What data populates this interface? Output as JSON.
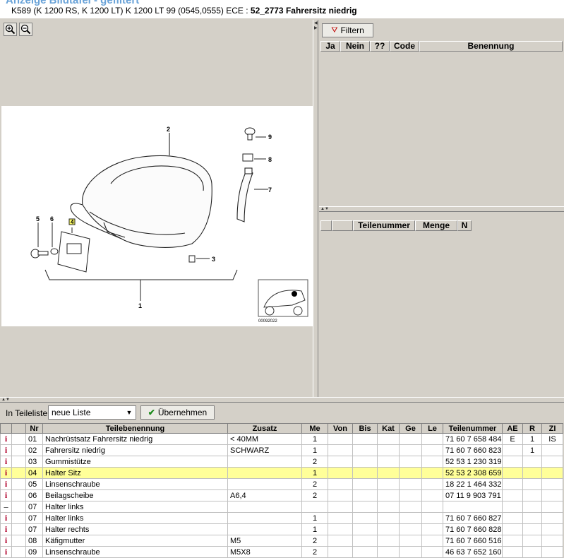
{
  "header": {
    "top_title": "Anzeige Bildtafel - gefiltert",
    "subtitle_prefix": "K589 (K 1200 RS, K 1200 LT) K 1200 LT 99 (0545,0555) ECE : ",
    "subtitle_bold": "52_2773 Fahrersitz niedrig"
  },
  "image_toolbar": {
    "zoom_in_icon": "zoom-in-icon",
    "zoom_out_icon": "zoom-out-icon"
  },
  "diagram": {
    "callouts": [
      "1",
      "2",
      "3",
      "4",
      "5",
      "6",
      "7",
      "8",
      "9"
    ],
    "image_code": "00092022"
  },
  "filter_panel": {
    "filter_label": "Filtern",
    "columns": [
      "Ja",
      "Nein",
      "??",
      "Code",
      "Benennung"
    ]
  },
  "detail_panel": {
    "columns": [
      "",
      "",
      "Teilenummer",
      "Menge",
      "N"
    ]
  },
  "parts_toolbar": {
    "list_label": "In Teileliste",
    "list_value": "neue Liste",
    "apply_label": "Übernehmen"
  },
  "parts_table": {
    "columns": [
      "",
      "Nr",
      "Teilebenennung",
      "Zusatz",
      "Me",
      "Von",
      "Bis",
      "Kat",
      "Ge",
      "Le",
      "Teilenummer",
      "AE",
      "R",
      "ZI"
    ],
    "rows": [
      {
        "icon": "i",
        "nr": "01",
        "name": "Nachrüstsatz Fahrersitz niedrig",
        "zusatz": "< 40MM",
        "me": "1",
        "von": "",
        "bis": "",
        "kat": "",
        "ge": "",
        "le": "",
        "teilenummer": "71 60 7 658 484",
        "ae": "E",
        "r": "1",
        "zi": "IS",
        "selected": false
      },
      {
        "icon": "i",
        "nr": "02",
        "name": "Fahrersitz niedrig",
        "zusatz": "SCHWARZ",
        "me": "1",
        "von": "",
        "bis": "",
        "kat": "",
        "ge": "",
        "le": "",
        "teilenummer": "71 60 7 660 823",
        "ae": "",
        "r": "1",
        "zi": "",
        "selected": false
      },
      {
        "icon": "i",
        "nr": "03",
        "name": "Gummistütze",
        "zusatz": "",
        "me": "2",
        "von": "",
        "bis": "",
        "kat": "",
        "ge": "",
        "le": "",
        "teilenummer": "52 53 1 230 319",
        "ae": "",
        "r": "",
        "zi": "",
        "selected": false
      },
      {
        "icon": "i",
        "nr": "04",
        "name": "Halter Sitz",
        "zusatz": "",
        "me": "1",
        "von": "",
        "bis": "",
        "kat": "",
        "ge": "",
        "le": "",
        "teilenummer": "52 53 2 308 659",
        "ae": "",
        "r": "",
        "zi": "",
        "selected": true
      },
      {
        "icon": "i",
        "nr": "05",
        "name": "Linsenschraube",
        "zusatz": "",
        "me": "2",
        "von": "",
        "bis": "",
        "kat": "",
        "ge": "",
        "le": "",
        "teilenummer": "18 22 1 464 332",
        "ae": "",
        "r": "",
        "zi": "",
        "selected": false
      },
      {
        "icon": "i",
        "nr": "06",
        "name": "Beilagscheibe",
        "zusatz": "A6,4",
        "me": "2",
        "von": "",
        "bis": "",
        "kat": "",
        "ge": "",
        "le": "",
        "teilenummer": "07 11 9 903 791",
        "ae": "",
        "r": "",
        "zi": "",
        "selected": false
      },
      {
        "icon": "–",
        "nr": "07",
        "name": "Halter links",
        "zusatz": "",
        "me": "",
        "von": "",
        "bis": "",
        "kat": "",
        "ge": "",
        "le": "",
        "teilenummer": "",
        "ae": "",
        "r": "",
        "zi": "",
        "selected": false
      },
      {
        "icon": "i",
        "nr": "07",
        "name": "Halter links",
        "zusatz": "",
        "me": "1",
        "von": "",
        "bis": "",
        "kat": "",
        "ge": "",
        "le": "",
        "teilenummer": "71 60 7 660 827",
        "ae": "",
        "r": "",
        "zi": "",
        "selected": false
      },
      {
        "icon": "i",
        "nr": "07",
        "name": "Halter rechts",
        "zusatz": "",
        "me": "1",
        "von": "",
        "bis": "",
        "kat": "",
        "ge": "",
        "le": "",
        "teilenummer": "71 60 7 660 828",
        "ae": "",
        "r": "",
        "zi": "",
        "selected": false
      },
      {
        "icon": "i",
        "nr": "08",
        "name": "Käfigmutter",
        "zusatz": "M5",
        "me": "2",
        "von": "",
        "bis": "",
        "kat": "",
        "ge": "",
        "le": "",
        "teilenummer": "71 60 7 660 516",
        "ae": "",
        "r": "",
        "zi": "",
        "selected": false
      },
      {
        "icon": "i",
        "nr": "09",
        "name": "Linsenschraube",
        "zusatz": "M5X8",
        "me": "2",
        "von": "",
        "bis": "",
        "kat": "",
        "ge": "",
        "le": "",
        "teilenummer": "46 63 7 652 160",
        "ae": "",
        "r": "",
        "zi": "",
        "selected": false
      }
    ]
  },
  "colors": {
    "selected_row": "#ffff99",
    "info_icon": "#b0002a",
    "title_blue": "#6aa3d8"
  }
}
